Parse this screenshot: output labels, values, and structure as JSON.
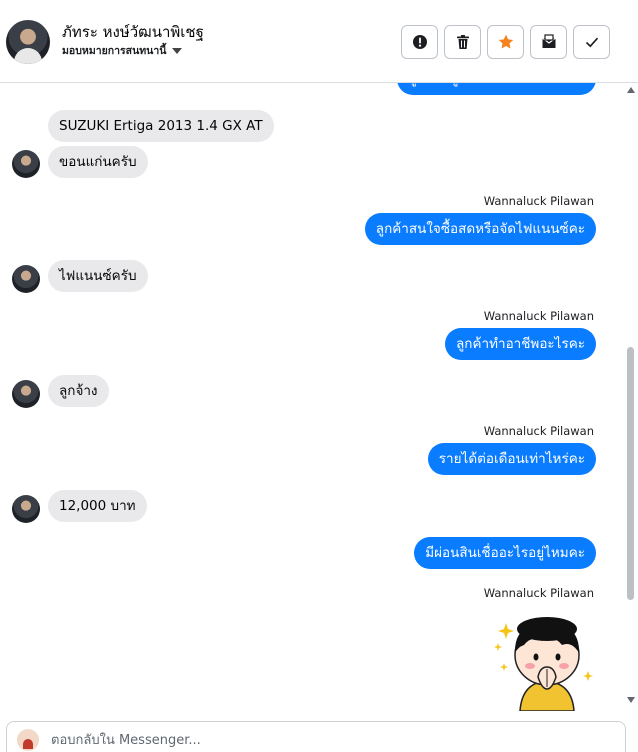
{
  "header": {
    "name": "ภัทระ หงษ์วัฒนาพิเชฐ",
    "subtitle": "มอบหมายการสนทนานี้"
  },
  "toolbar": {
    "buttons": [
      {
        "icon": "alert-icon"
      },
      {
        "icon": "trash-icon"
      },
      {
        "icon": "star-icon",
        "color": "#f5821f"
      },
      {
        "icon": "mail-icon"
      },
      {
        "icon": "check-icon"
      }
    ]
  },
  "messages": [
    {
      "dir": "out",
      "text": "ลูกค้ามีผู้ค้ำประกันหรือเปล่าคะ",
      "partial": true
    },
    {
      "dir": "in",
      "text": "SUZUKI Ertiga 2013 1.4 GX AT"
    },
    {
      "dir": "in",
      "text": "ขอนแก่นครับ"
    },
    {
      "dir": "out",
      "sender": "Wannaluck Pilawan",
      "text": "ลูกค้าสนใจซื้อสดหรือจัดไฟแนนซ์คะ"
    },
    {
      "dir": "in",
      "text": "ไฟแนนซ์ครับ"
    },
    {
      "dir": "out",
      "sender": "Wannaluck Pilawan",
      "text": "ลูกค้าทำอาชีพอะไรคะ"
    },
    {
      "dir": "in",
      "text": "ลูกจ้าง"
    },
    {
      "dir": "out",
      "sender": "Wannaluck Pilawan",
      "text": "รายได้ต่อเดือนเท่าไหร่คะ"
    },
    {
      "dir": "in",
      "text": "12,000 บาท"
    },
    {
      "dir": "out",
      "text": "มีผ่อนสินเชื่ออะไรอยู่ไหมคะ"
    },
    {
      "dir": "out",
      "sender": "Wannaluck Pilawan",
      "sticker": "girl-praying-sticker"
    }
  ],
  "composer": {
    "placeholder": "ตอบกลับใน Messenger..."
  },
  "colors": {
    "outgoing": "#0a7cff",
    "incoming": "#e9e9eb"
  }
}
